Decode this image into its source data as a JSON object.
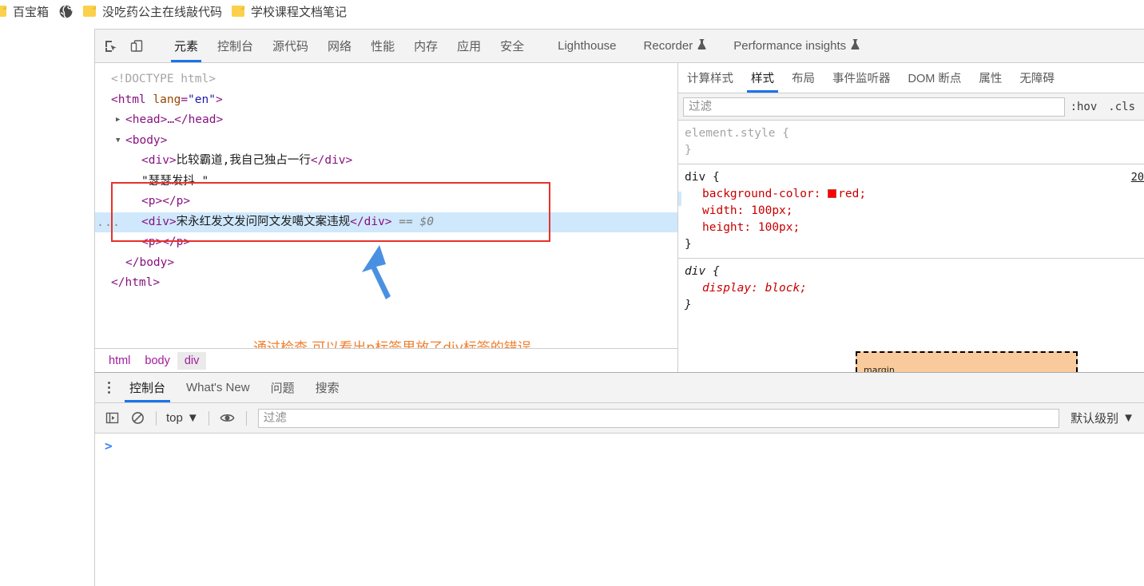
{
  "bookmarks": {
    "items": [
      {
        "label": "百宝箱",
        "icon": "folder-icon"
      },
      {
        "label": "",
        "icon": "globe-icon"
      },
      {
        "label": "没吃药公主在线敲代码",
        "icon": "folder-icon"
      },
      {
        "label": "学校课程文档笔记",
        "icon": "folder-icon"
      }
    ]
  },
  "devtools": {
    "toolbar_icons": [
      {
        "name": "inspect-element-icon",
        "title": "检查元素"
      },
      {
        "name": "device-toolbar-icon",
        "title": "设备工具栏"
      }
    ],
    "tabs": [
      {
        "label": "元素",
        "selected": true
      },
      {
        "label": "控制台",
        "selected": false
      },
      {
        "label": "源代码",
        "selected": false
      },
      {
        "label": "网络",
        "selected": false
      },
      {
        "label": "性能",
        "selected": false
      },
      {
        "label": "内存",
        "selected": false
      },
      {
        "label": "应用",
        "selected": false
      },
      {
        "label": "安全",
        "selected": false
      },
      {
        "label": "Lighthouse",
        "selected": false
      },
      {
        "label": "Recorder",
        "selected": false,
        "flask": true
      },
      {
        "label": "Performance insights",
        "selected": false,
        "flask": true
      }
    ]
  },
  "dom": {
    "lines": {
      "doctype": "<!DOCTYPE html>",
      "html_open_tag": "<html",
      "html_attr_name": "lang",
      "html_attr_value": "\"en\"",
      "html_open_close": ">",
      "head_collapsed": "<head>…</head>",
      "body_open": "<body>",
      "div1_open": "<div>",
      "div1_text": "比较霸道,我自己独占一行",
      "div1_close": "</div>",
      "text_node": "\"瑟瑟发抖 \"",
      "p1": "<p></p>",
      "div2_open": "<div>",
      "div2_text": "宋永红发文发问阿文发噶文案违规",
      "div2_close": "</div>",
      "div2_marker": "== $0",
      "p2": "<p></p>",
      "body_close": "</body>",
      "html_close": "</html>",
      "ellipsis_badge": "..."
    },
    "annotation": {
      "text": "通过检查,可以看出p标签里放了div标签的错误",
      "color": "#f08030",
      "box_color": "#e8312a",
      "arrow_color": "#4a90e2"
    },
    "breadcrumb": [
      {
        "label": "html",
        "selected": false
      },
      {
        "label": "body",
        "selected": false
      },
      {
        "label": "div",
        "selected": true
      }
    ]
  },
  "styles": {
    "tabs": [
      {
        "label": "计算样式",
        "selected": false
      },
      {
        "label": "样式",
        "selected": true
      },
      {
        "label": "布局",
        "selected": false
      },
      {
        "label": "事件监听器",
        "selected": false
      },
      {
        "label": "DOM 断点",
        "selected": false
      },
      {
        "label": "属性",
        "selected": false
      },
      {
        "label": "无障碍",
        "selected": false
      }
    ],
    "filter_placeholder": "过滤",
    "filter_value": "",
    "hov_button": ":hov",
    "cls_button": ".cls",
    "rules": [
      {
        "selector": "element.style",
        "open": "{",
        "close": "}",
        "source": "",
        "declarations": []
      },
      {
        "selector": "div",
        "open": "{",
        "close": "}",
        "source": "20",
        "declarations": [
          {
            "prop": "background-color",
            "value": "red",
            "swatch": "#ff0000"
          },
          {
            "prop": "width",
            "value": "100px",
            "swatch": ""
          },
          {
            "prop": "height",
            "value": "100px",
            "swatch": ""
          }
        ]
      },
      {
        "selector": "div",
        "open": "{",
        "close": "}",
        "source": "",
        "user_agent": true,
        "declarations": [
          {
            "prop": "display",
            "value": "block",
            "swatch": ""
          }
        ]
      }
    ],
    "box_model_label": "margin"
  },
  "console": {
    "tabs": [
      {
        "label": "控制台",
        "selected": true
      },
      {
        "label": "What's New",
        "selected": false
      },
      {
        "label": "问题",
        "selected": false
      },
      {
        "label": "搜索",
        "selected": false
      }
    ],
    "toolbar": {
      "sidebar_icon": "console-sidebar-icon",
      "clear_icon": "clear-console-icon",
      "context_label": "top",
      "eye_icon": "live-expression-icon",
      "filter_placeholder": "过滤",
      "filter_value": "",
      "level_label": "默认级别"
    },
    "prompt_caret": ">"
  }
}
